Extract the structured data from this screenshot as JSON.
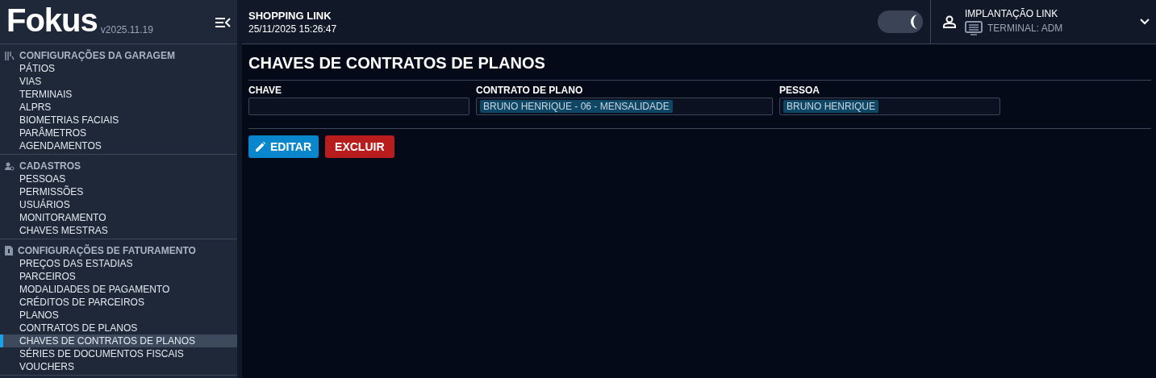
{
  "sidebar": {
    "logo": "Fokus",
    "version": "v2025.11.19",
    "sections": [
      {
        "title": "CONFIGURAÇÕES DA GARAGEM",
        "kind": "garage",
        "items": [
          {
            "label": "PÁTIOS",
            "selected": false
          },
          {
            "label": "VIAS",
            "selected": false
          },
          {
            "label": "TERMINAIS",
            "selected": false
          },
          {
            "label": "ALPRS",
            "selected": false
          },
          {
            "label": "BIOMETRIAS FACIAIS",
            "selected": false
          },
          {
            "label": "PARÂMETROS",
            "selected": false
          },
          {
            "label": "AGENDAMENTOS",
            "selected": false
          }
        ]
      },
      {
        "title": "CADASTROS",
        "kind": "people",
        "items": [
          {
            "label": "PESSOAS",
            "selected": false
          },
          {
            "label": "PERMISSÕES",
            "selected": false
          },
          {
            "label": "USUÁRIOS",
            "selected": false
          },
          {
            "label": "MONITORAMENTO",
            "selected": false
          },
          {
            "label": "CHAVES MESTRAS",
            "selected": false
          }
        ]
      },
      {
        "title": "CONFIGURAÇÕES DE FATURAMENTO",
        "kind": "billing",
        "items": [
          {
            "label": "PREÇOS DAS ESTADIAS",
            "selected": false
          },
          {
            "label": "PARCEIROS",
            "selected": false
          },
          {
            "label": "MODALIDADES DE PAGAMENTO",
            "selected": false
          },
          {
            "label": "CRÉDITOS DE PARCEIROS",
            "selected": false
          },
          {
            "label": "PLANOS",
            "selected": false
          },
          {
            "label": "CONTRATOS DE PLANOS",
            "selected": false
          },
          {
            "label": "CHAVES DE CONTRATOS DE PLANOS",
            "selected": true
          },
          {
            "label": "SÉRIES DE DOCUMENTOS FISCAIS",
            "selected": false
          },
          {
            "label": "VOUCHERS",
            "selected": false
          }
        ]
      }
    ]
  },
  "header": {
    "title": "SHOPPING LINK",
    "datetime": "25/11/2025 15:26:47",
    "dark_mode": {
      "on": true
    },
    "user": {
      "name": "IMPLANTAÇÃO LINK",
      "terminal": "TERMINAL: ADM"
    }
  },
  "page": {
    "title": "CHAVES DE CONTRATOS DE PLANOS",
    "fields": [
      {
        "label": "CHAVE"
      },
      {
        "label": "CONTRATO DE PLANO",
        "tags": [
          "BRUNO HENRIQUE - 06 - MENSALIDADE"
        ]
      },
      {
        "label": "PESSOA",
        "tags": [
          "BRUNO HENRIQUE"
        ]
      }
    ],
    "buttons": [
      {
        "label": "EDITAR",
        "kind": "edit"
      },
      {
        "label": "EXCLUIR",
        "kind": "delete"
      }
    ]
  }
}
